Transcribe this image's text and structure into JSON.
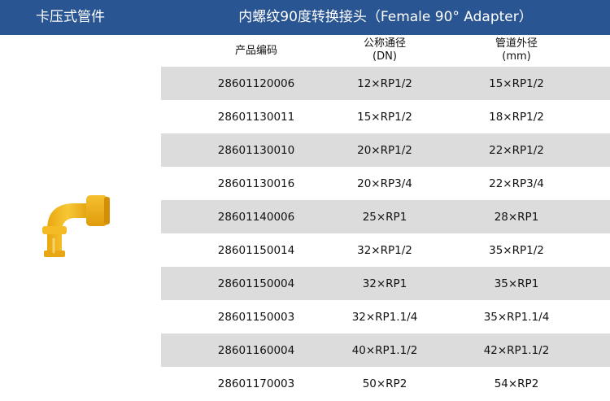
{
  "header": {
    "category": "卡压式管件",
    "title": "内螺纹90度转换接头（Female 90° Adapter）"
  },
  "columns": {
    "code": "产品编码",
    "dn_line1": "公称通径",
    "dn_line2": "(DN)",
    "od_line1": "管道外径",
    "od_line2": "(mm)"
  },
  "rows": [
    {
      "code": "28601120006",
      "dn": "12×RP1/2",
      "od": "15×RP1/2"
    },
    {
      "code": "28601130011",
      "dn": "15×RP1/2",
      "od": "18×RP1/2"
    },
    {
      "code": "28601130010",
      "dn": "20×RP1/2",
      "od": "22×RP1/2"
    },
    {
      "code": "28601130016",
      "dn": "20×RP3/4",
      "od": "22×RP3/4"
    },
    {
      "code": "28601140006",
      "dn": "25×RP1",
      "od": "28×RP1"
    },
    {
      "code": "28601150014",
      "dn": "32×RP1/2",
      "od": "35×RP1/2"
    },
    {
      "code": "28601150004",
      "dn": "32×RP1",
      "od": "35×RP1"
    },
    {
      "code": "28601150003",
      "dn": "32×RP1.1/4",
      "od": "35×RP1.1/4"
    },
    {
      "code": "28601160004",
      "dn": "40×RP1.1/2",
      "od": "42×RP1.1/2"
    },
    {
      "code": "28601170003",
      "dn": "50×RP2",
      "od": "54×RP2"
    }
  ],
  "colors": {
    "header_bg": "#2a5593",
    "row_shade": "#dcdcdc",
    "fitting": "#f2b81c"
  }
}
